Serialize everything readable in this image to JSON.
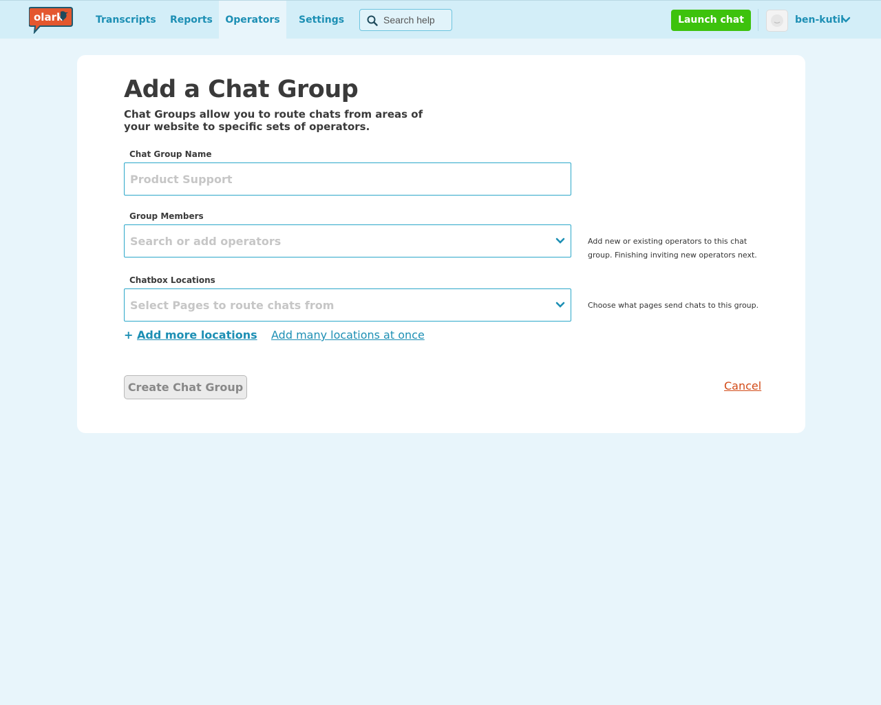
{
  "nav": {
    "logo_text": "olark",
    "items": [
      {
        "label": "Transcripts",
        "active": false
      },
      {
        "label": "Reports",
        "active": false
      },
      {
        "label": "Operators",
        "active": true
      },
      {
        "label": "Settings",
        "active": false
      }
    ],
    "search_placeholder": "Search help",
    "launch_label": "Launch chat",
    "username": "ben-kutil"
  },
  "page": {
    "title": "Add a Chat Group",
    "subtitle": "Chat Groups allow you to route chats from areas of your website to specific sets of operators.",
    "group_name": {
      "label": "Chat Group Name",
      "placeholder": "Product Support",
      "value": ""
    },
    "members": {
      "label": "Group Members",
      "placeholder": "Search or add operators",
      "help": "Add new or existing operators to this chat group. Finishing inviting new operators next."
    },
    "locations": {
      "label": "Chatbox Locations",
      "placeholder": "Select Pages to route chats from",
      "help": "Choose what pages send chats to this group."
    },
    "add_more_plus": "+",
    "add_more_label": "Add more locations",
    "add_many_label": "Add many locations at once",
    "create_label": "Create Chat Group",
    "cancel_label": "Cancel"
  },
  "colors": {
    "accent": "#1d8fb4",
    "launch": "#3dc20d",
    "cancel": "#d24a17",
    "brand": "#e4572e",
    "background": "#e8f5fb"
  },
  "icons": [
    "olark-logo",
    "search-icon",
    "chevron-down-icon",
    "avatar-icon"
  ]
}
